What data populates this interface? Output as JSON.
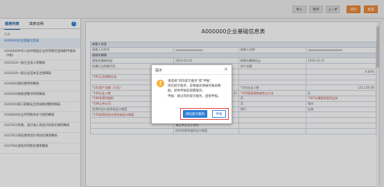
{
  "toolbar": {
    "buttons": [
      {
        "label": "导入"
      },
      {
        "label": "暂存"
      },
      {
        "label": "上一步"
      },
      {
        "label": "保存"
      },
      {
        "label": "重置"
      }
    ]
  },
  "sidebar": {
    "tabs": [
      "报表列表",
      "填表说明"
    ],
    "tip": "列表",
    "items": [
      "A000000企业基础信息表",
      "A100000中华人民共和国企业所得税年度纳税申报表（A类）",
      "A101010一般企业收入明细表",
      "A102010一般企业成本支出明细表",
      "A104000期间费用明细表",
      "A105000纳税调整项目明细表",
      "A105050职工薪酬支出及纳税调整明细表",
      "A106000企业所得税弥补亏损明细表",
      "A107010免税、减计收入及加计扣除优惠明细表",
      "A107012研发费用加计扣除优惠明细表",
      "A107040减免所得税优惠明细表"
    ]
  },
  "main": {
    "title": "A000000企业基础信息表",
    "rows": [
      {
        "cells": [
          "纳税人信息"
        ]
      },
      {
        "cells": [
          "纳税人识别号",
          "",
          "纳税人名称",
          ""
        ]
      },
      {
        "cells": [
          "税款所属期"
        ]
      },
      {
        "cells": [
          "税款所属期间起",
          "2019-01-01",
          "税款所属期间止",
          "2019-12-31"
        ]
      },
      {
        "cells": [
          "所属行业明细代码",
          "",
          "资产总额",
          ""
        ]
      },
      {
        "cells": [
          "",
          "",
          "",
          "0.00%"
        ]
      },
      {
        "cells": [
          "*101汇总纳税企业",
          "",
          "",
          ""
        ]
      },
      {
        "cells": [
          "",
          "",
          "",
          ""
        ]
      },
      {
        "cells": [
          "*103资产总额（万元）",
          "",
          "*104从业人数",
          "121,140.00"
        ]
      },
      {
        "cells": [
          "*104从业人数",
          "4.12",
          "*105国家限制或禁止行业",
          "否"
        ]
      },
      {
        "cells": [
          "*106非营利组织",
          "是",
          "否",
          "*107从事股权投资业务"
        ]
      },
      {
        "cells": [
          "*108上市公司",
          "是",
          "否",
          "境内"
        ]
      },
      {
        "cells": [
          "适用的会计准则或会计制度",
          "一般企业",
          "银行",
          "证券"
        ]
      },
      {
        "cells": [
          "*110适用的会计准则或会计制度",
          "企业会计准则",
          "",
          ""
        ]
      },
      {
        "cells": [
          "",
          "小企业会计准则",
          "",
          ""
        ]
      },
      {
        "cells": [
          "",
          "事业单位会计准则",
          "",
          ""
        ]
      },
      {
        "cells": [
          "",
          "民间非营利组织会计制度",
          "",
          ""
        ]
      }
    ]
  },
  "dialog": {
    "title": "提示",
    "close_glyph": "×",
    "message_lines": [
      "请选择\"风险提示服务\"或\"申报\"",
      "风险提示服务，是根据您填报的报表数",
      "据，提供申报前提醒服务。",
      "申报：跳过风险提示服务，直接申报。"
    ],
    "primary_label": "风险提示服务",
    "secondary_label": "申报",
    "warn_glyph": "!"
  },
  "colors": {
    "accent": "#2f80d8",
    "highlight": "#e23b3b",
    "orange": "#f08c3a"
  }
}
